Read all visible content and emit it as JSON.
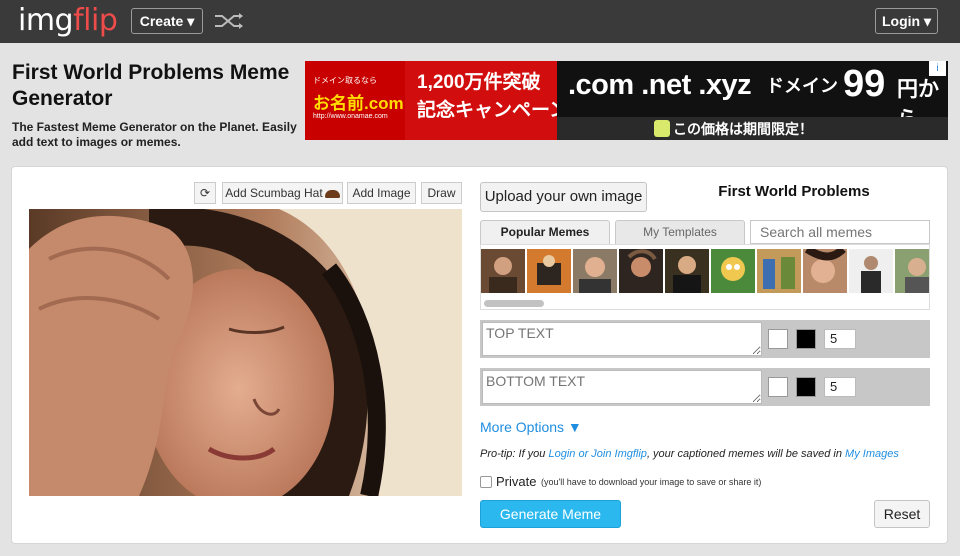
{
  "header": {
    "logo_img": "img",
    "logo_flip": "flip",
    "create_label": "Create ▾",
    "shuffle_icon": "shuffle-icon",
    "login_label": "Login ▾"
  },
  "page": {
    "title": "First World Problems Meme Generator",
    "tagline": "The Fastest Meme Generator on the Planet. Easily add text to images or memes."
  },
  "ad": {
    "line_small_top": "ドメイン取るなら",
    "logo": "お名前.com",
    "url_small": "http://www.onamae.com",
    "mid_line1": "1,200万件突破",
    "mid_line2": "記念キャンペーン",
    "domains": ".com .net .xyz",
    "price_label": "ドメイン",
    "price_number": "99",
    "price_suffix": "円から",
    "limited": "この価格は期間限定！",
    "info_icon": "i"
  },
  "editor": {
    "rotate_icon": "⟳",
    "scumbag_hat_label": "Add Scumbag Hat",
    "add_image_label": "Add Image",
    "draw_label": "Draw"
  },
  "sidebar": {
    "upload_label": "Upload your own image",
    "meme_name": "First World Problems",
    "tabs": [
      {
        "label": "Popular Memes",
        "active": true
      },
      {
        "label": "My Templates",
        "active": false
      }
    ],
    "search_placeholder": "Search all memes",
    "thumbnails": [
      "meme-thumb-1",
      "meme-thumb-2",
      "meme-thumb-3",
      "meme-thumb-4",
      "meme-thumb-5",
      "meme-thumb-6",
      "meme-thumb-7",
      "meme-thumb-8",
      "meme-thumb-9",
      "meme-thumb-10"
    ]
  },
  "text_boxes": [
    {
      "placeholder": "TOP TEXT",
      "outline_color": "#ffffff",
      "fill_color": "#000000",
      "size": "5"
    },
    {
      "placeholder": "BOTTOM TEXT",
      "outline_color": "#ffffff",
      "fill_color": "#000000",
      "size": "5"
    }
  ],
  "options": {
    "more_options": "More Options ▼",
    "protip_prefix": "Pro-tip: If you ",
    "protip_link1": "Login or Join Imgflip",
    "protip_middle": ", your captioned memes will be saved in ",
    "protip_link2": "My Images",
    "private_label": "Private",
    "private_note": "(you'll have to download your image to save or share it)",
    "generate_label": "Generate Meme",
    "reset_label": "Reset"
  },
  "colors": {
    "topbar": "#3a3a3a",
    "logo_accent": "#ee4b4b",
    "link": "#1f8ee0",
    "generate": "#2ab8ee"
  }
}
